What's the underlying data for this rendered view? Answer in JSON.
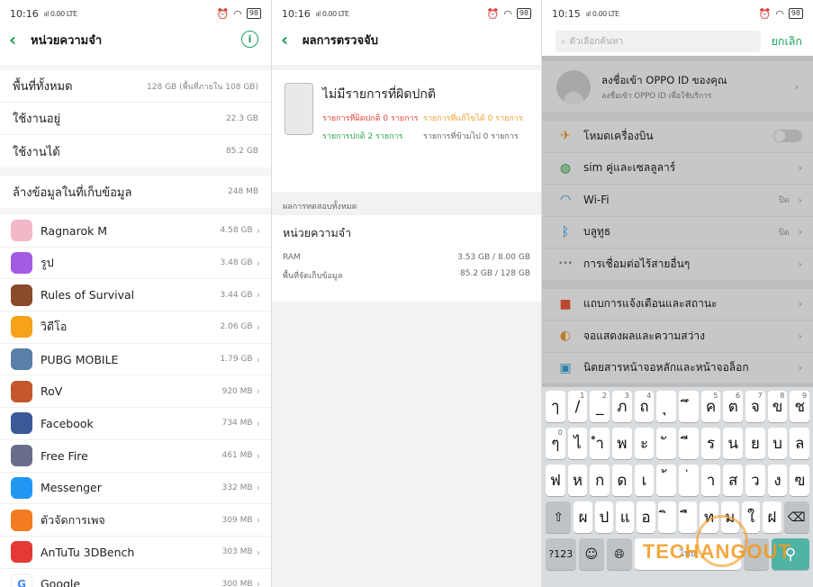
{
  "status": {
    "time1": "10:16",
    "time2": "10:16",
    "time3": "10:15",
    "battery": "98",
    "signal": "ııl 0.00 LTE"
  },
  "storage": {
    "title": "หน่วยความจำ",
    "total_label": "พื้นที่ทั้งหมด",
    "total_value": "128 GB (พื้นที่ภายใน 108 GB)",
    "used_label": "ใช้งานอยู่",
    "used_value": "22.3 GB",
    "free_label": "ใช้งานได้",
    "free_value": "85.2 GB",
    "clean_label": "ล้างข้อมูลในที่เก็บข้อมูล",
    "clean_value": "248 MB",
    "apps": [
      {
        "name": "Ragnarok M",
        "size": "4.58 GB",
        "color": "#f2b8c8"
      },
      {
        "name": "รูป",
        "size": "3.48 GB",
        "color": "#a45be3"
      },
      {
        "name": "Rules of Survival",
        "size": "3.44 GB",
        "color": "#8a4b2a"
      },
      {
        "name": "วิดีโอ",
        "size": "2.06 GB",
        "color": "#f7a21b"
      },
      {
        "name": "PUBG MOBILE",
        "size": "1.79 GB",
        "color": "#5a7fa8"
      },
      {
        "name": "RoV",
        "size": "920 MB",
        "color": "#c4582c"
      },
      {
        "name": "Facebook",
        "size": "734 MB",
        "color": "#3b5998"
      },
      {
        "name": "Free Fire",
        "size": "461 MB",
        "color": "#6b6e8a"
      },
      {
        "name": "Messenger",
        "size": "332 MB",
        "color": "#2196f3"
      },
      {
        "name": "ตัวจัดการเพจ",
        "size": "309 MB",
        "color": "#f47b20"
      },
      {
        "name": "AnTuTu 3DBench",
        "size": "303 MB",
        "color": "#e53935"
      },
      {
        "name": "Google",
        "size": "300 MB",
        "color": "#ffffff"
      }
    ]
  },
  "scan": {
    "title": "ผลการตรวจจับ",
    "headline": "ไม่มีรายการที่ผิดปกติ",
    "abnormal": "รายการที่ผิดปกติ 0 รายการ",
    "fixable": "รายการที่แก้ไขได้ 0 รายการ",
    "normal": "รายการปกติ 2 รายการ",
    "skipped": "รายการที่ข้ามไป 0 รายการ",
    "section": "ผลการทดสอบทั้งหมด",
    "mem_title": "หน่วยความจำ",
    "ram_label": "RAM",
    "ram_value": "3.53 GB / 8.00 GB",
    "storage_label": "พื้นที่จัดเก็บข้อมูล",
    "storage_value": "85.2 GB / 128 GB"
  },
  "settings": {
    "search_placeholder": "ตัวเลือกค้นหา",
    "cancel": "ยกเลิก",
    "account_title": "ลงชื่อเข้า OPPO ID ของคุณ",
    "account_sub": "ลงชื่อเข้า OPPO ID เพื่อใช้บริการ",
    "items": [
      {
        "label": "โหมดเครื่องบิน",
        "value": "",
        "icon": "airplane-icon",
        "color": "#f0a030"
      },
      {
        "label": "sim คู่และเซลลูลาร์",
        "value": "",
        "icon": "globe-icon",
        "color": "#2ea84b"
      },
      {
        "label": "Wi-Fi",
        "value": "ปิด",
        "icon": "wifi-icon",
        "color": "#2196f3"
      },
      {
        "label": "บลูทูธ",
        "value": "ปิด",
        "icon": "bluetooth-icon",
        "color": "#2196f3"
      },
      {
        "label": "การเชื่อมต่อไร้สายอื่นๆ",
        "value": "",
        "icon": "more-icon",
        "color": "#8a8a8a"
      },
      {
        "label": "แถบการแจ้งเตือนและสถานะ",
        "value": "",
        "icon": "notification-icon",
        "color": "#f25c3c"
      },
      {
        "label": "จอแสดงผลและความสว่าง",
        "value": "",
        "icon": "brightness-icon",
        "color": "#f0a030"
      },
      {
        "label": "นิตยสารหน้าจอหลักและหน้าจอล็อก",
        "value": "",
        "icon": "magazine-icon",
        "color": "#39a7d8"
      }
    ]
  },
  "keyboard": {
    "row1": [
      "ๅ",
      "/",
      "_",
      "ภ",
      "ถ",
      "ุ",
      "ึ",
      "ค",
      "ต",
      "จ",
      "ข",
      "ช"
    ],
    "row1_sup": [
      "",
      "1",
      "2",
      "3",
      "4",
      "",
      "",
      "5",
      "6",
      "7",
      "8",
      "9"
    ],
    "row2": [
      "ๆ",
      "ไ",
      "ำ",
      "พ",
      "ะ",
      "ั",
      "ี",
      "ร",
      "น",
      "ย",
      "บ",
      "ล"
    ],
    "row2_sup": [
      "0",
      "",
      "",
      "",
      "",
      "",
      "",
      "",
      "",
      "",
      "",
      ""
    ],
    "row3": [
      "ฟ",
      "ห",
      "ก",
      "ด",
      "เ",
      "้",
      "่",
      "า",
      "ส",
      "ว",
      "ง",
      "ฃ"
    ],
    "row4": [
      "ผ",
      "ป",
      "แ",
      "อ",
      "ิ",
      "ื",
      "ท",
      "ม",
      "ใ",
      "ฝ"
    ],
    "num_key": "?123",
    "space_label": "ไทย",
    "period": "."
  },
  "watermark": "TECHANGOUT"
}
